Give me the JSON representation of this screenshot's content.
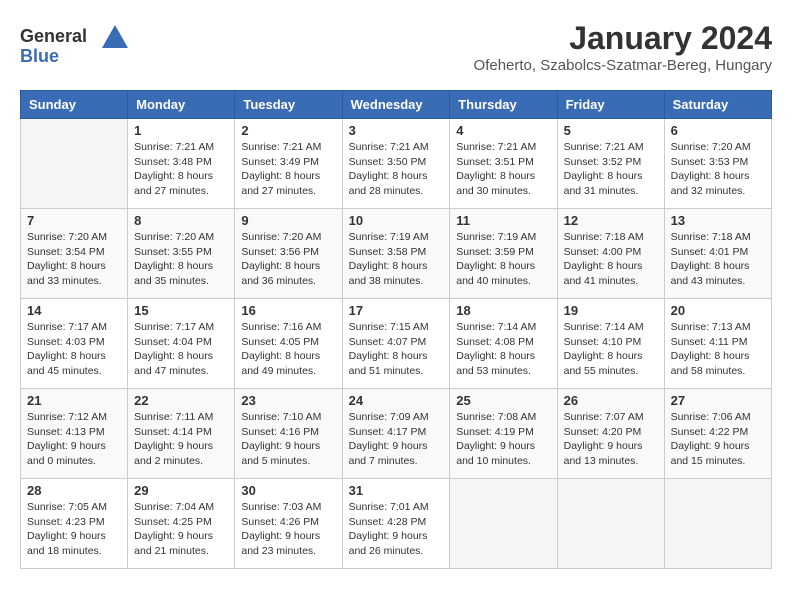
{
  "header": {
    "logo_line1": "General",
    "logo_line2": "Blue",
    "month": "January 2024",
    "location": "Ofeherto, Szabolcs-Szatmar-Bereg, Hungary"
  },
  "days_of_week": [
    "Sunday",
    "Monday",
    "Tuesday",
    "Wednesday",
    "Thursday",
    "Friday",
    "Saturday"
  ],
  "weeks": [
    [
      {
        "day": "",
        "info": ""
      },
      {
        "day": "1",
        "info": "Sunrise: 7:21 AM\nSunset: 3:48 PM\nDaylight: 8 hours\nand 27 minutes."
      },
      {
        "day": "2",
        "info": "Sunrise: 7:21 AM\nSunset: 3:49 PM\nDaylight: 8 hours\nand 27 minutes."
      },
      {
        "day": "3",
        "info": "Sunrise: 7:21 AM\nSunset: 3:50 PM\nDaylight: 8 hours\nand 28 minutes."
      },
      {
        "day": "4",
        "info": "Sunrise: 7:21 AM\nSunset: 3:51 PM\nDaylight: 8 hours\nand 30 minutes."
      },
      {
        "day": "5",
        "info": "Sunrise: 7:21 AM\nSunset: 3:52 PM\nDaylight: 8 hours\nand 31 minutes."
      },
      {
        "day": "6",
        "info": "Sunrise: 7:20 AM\nSunset: 3:53 PM\nDaylight: 8 hours\nand 32 minutes."
      }
    ],
    [
      {
        "day": "7",
        "info": "Sunrise: 7:20 AM\nSunset: 3:54 PM\nDaylight: 8 hours\nand 33 minutes."
      },
      {
        "day": "8",
        "info": "Sunrise: 7:20 AM\nSunset: 3:55 PM\nDaylight: 8 hours\nand 35 minutes."
      },
      {
        "day": "9",
        "info": "Sunrise: 7:20 AM\nSunset: 3:56 PM\nDaylight: 8 hours\nand 36 minutes."
      },
      {
        "day": "10",
        "info": "Sunrise: 7:19 AM\nSunset: 3:58 PM\nDaylight: 8 hours\nand 38 minutes."
      },
      {
        "day": "11",
        "info": "Sunrise: 7:19 AM\nSunset: 3:59 PM\nDaylight: 8 hours\nand 40 minutes."
      },
      {
        "day": "12",
        "info": "Sunrise: 7:18 AM\nSunset: 4:00 PM\nDaylight: 8 hours\nand 41 minutes."
      },
      {
        "day": "13",
        "info": "Sunrise: 7:18 AM\nSunset: 4:01 PM\nDaylight: 8 hours\nand 43 minutes."
      }
    ],
    [
      {
        "day": "14",
        "info": "Sunrise: 7:17 AM\nSunset: 4:03 PM\nDaylight: 8 hours\nand 45 minutes."
      },
      {
        "day": "15",
        "info": "Sunrise: 7:17 AM\nSunset: 4:04 PM\nDaylight: 8 hours\nand 47 minutes."
      },
      {
        "day": "16",
        "info": "Sunrise: 7:16 AM\nSunset: 4:05 PM\nDaylight: 8 hours\nand 49 minutes."
      },
      {
        "day": "17",
        "info": "Sunrise: 7:15 AM\nSunset: 4:07 PM\nDaylight: 8 hours\nand 51 minutes."
      },
      {
        "day": "18",
        "info": "Sunrise: 7:14 AM\nSunset: 4:08 PM\nDaylight: 8 hours\nand 53 minutes."
      },
      {
        "day": "19",
        "info": "Sunrise: 7:14 AM\nSunset: 4:10 PM\nDaylight: 8 hours\nand 55 minutes."
      },
      {
        "day": "20",
        "info": "Sunrise: 7:13 AM\nSunset: 4:11 PM\nDaylight: 8 hours\nand 58 minutes."
      }
    ],
    [
      {
        "day": "21",
        "info": "Sunrise: 7:12 AM\nSunset: 4:13 PM\nDaylight: 9 hours\nand 0 minutes."
      },
      {
        "day": "22",
        "info": "Sunrise: 7:11 AM\nSunset: 4:14 PM\nDaylight: 9 hours\nand 2 minutes."
      },
      {
        "day": "23",
        "info": "Sunrise: 7:10 AM\nSunset: 4:16 PM\nDaylight: 9 hours\nand 5 minutes."
      },
      {
        "day": "24",
        "info": "Sunrise: 7:09 AM\nSunset: 4:17 PM\nDaylight: 9 hours\nand 7 minutes."
      },
      {
        "day": "25",
        "info": "Sunrise: 7:08 AM\nSunset: 4:19 PM\nDaylight: 9 hours\nand 10 minutes."
      },
      {
        "day": "26",
        "info": "Sunrise: 7:07 AM\nSunset: 4:20 PM\nDaylight: 9 hours\nand 13 minutes."
      },
      {
        "day": "27",
        "info": "Sunrise: 7:06 AM\nSunset: 4:22 PM\nDaylight: 9 hours\nand 15 minutes."
      }
    ],
    [
      {
        "day": "28",
        "info": "Sunrise: 7:05 AM\nSunset: 4:23 PM\nDaylight: 9 hours\nand 18 minutes."
      },
      {
        "day": "29",
        "info": "Sunrise: 7:04 AM\nSunset: 4:25 PM\nDaylight: 9 hours\nand 21 minutes."
      },
      {
        "day": "30",
        "info": "Sunrise: 7:03 AM\nSunset: 4:26 PM\nDaylight: 9 hours\nand 23 minutes."
      },
      {
        "day": "31",
        "info": "Sunrise: 7:01 AM\nSunset: 4:28 PM\nDaylight: 9 hours\nand 26 minutes."
      },
      {
        "day": "",
        "info": ""
      },
      {
        "day": "",
        "info": ""
      },
      {
        "day": "",
        "info": ""
      }
    ]
  ]
}
